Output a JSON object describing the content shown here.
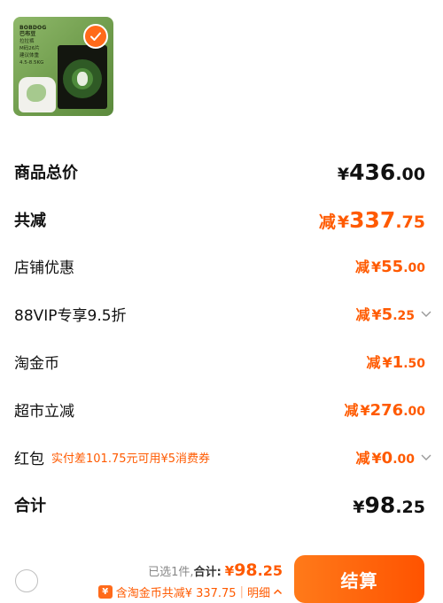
{
  "product": {
    "image_text": {
      "brand": "BOBDOG\n巴布豆",
      "spec": "拉拉裤\nM码26片\n建议体重\n4.5-8.5KG"
    }
  },
  "price_rows": [
    {
      "label": "商品总价",
      "jian": "",
      "yen": "¥",
      "int": "436",
      "dec": ".00"
    },
    {
      "label": "共减",
      "jian": "减",
      "yen": "¥",
      "int": "337",
      "dec": ".75"
    },
    {
      "label": "店铺优惠",
      "jian": "减",
      "yen": "¥",
      "int": "55",
      "dec": ".00"
    },
    {
      "label": "88VIP专享9.5折",
      "jian": "减",
      "yen": "¥",
      "int": "5",
      "dec": ".25"
    },
    {
      "label": "淘金币",
      "jian": "减",
      "yen": "¥",
      "int": "1",
      "dec": ".50"
    },
    {
      "label": "超市立减",
      "jian": "减",
      "yen": "¥",
      "int": "276",
      "dec": ".00"
    },
    {
      "label": "红包",
      "note": "实付差101.75元可用¥5消费券",
      "jian": "减",
      "yen": "¥",
      "int": "0",
      "dec": ".00"
    },
    {
      "label": "合计",
      "jian": "",
      "yen": "¥",
      "int": "98",
      "dec": ".25"
    }
  ],
  "footer": {
    "selected": "已选1件,",
    "total_label": "合计:",
    "yen": "¥",
    "int": "98",
    "dec": ".25",
    "coin_icon": "¥",
    "coin_text": "含淘金币共减¥ 337.75",
    "detail": "明细",
    "checkout": "结算"
  },
  "colors": {
    "accent": "#ff5a00",
    "radio": "#bfbfbf"
  }
}
